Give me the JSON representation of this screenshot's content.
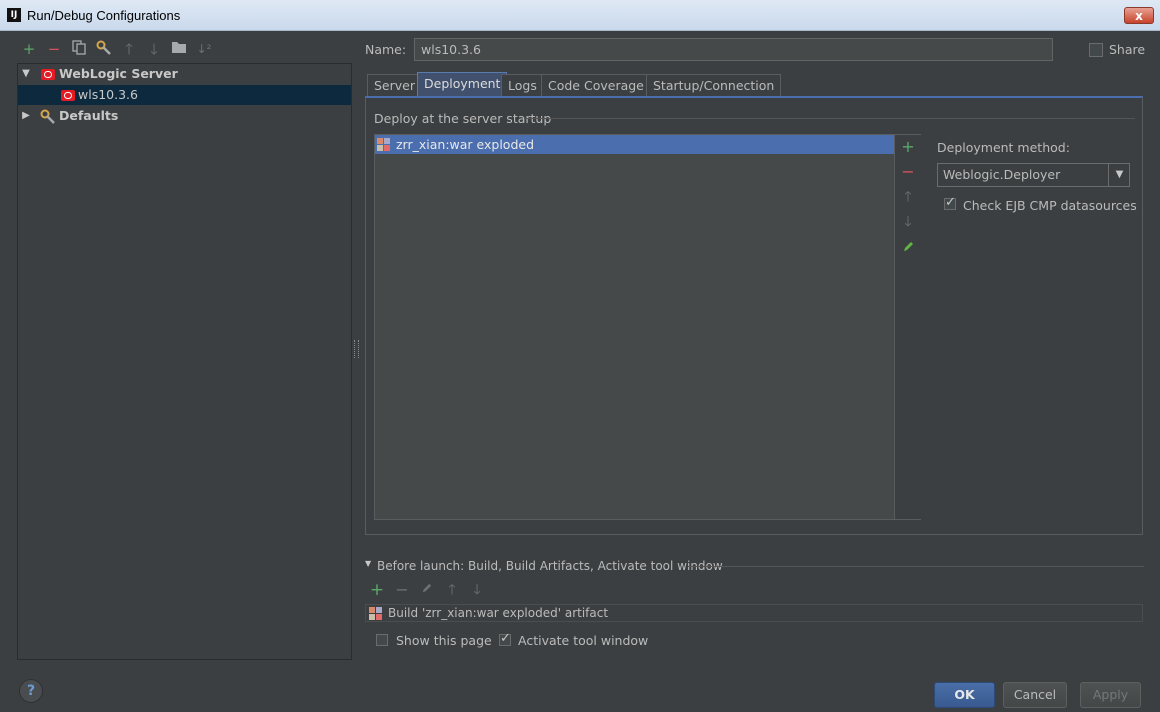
{
  "window": {
    "title": "Run/Debug Configurations",
    "app_icon": "intellij-logo-icon",
    "close_label": "x"
  },
  "toolbar": {
    "icons": [
      "add-icon",
      "remove-icon",
      "copy-icon",
      "edit-defaults-icon",
      "move-up-icon",
      "move-down-icon",
      "folder-icon",
      "sort-icon"
    ]
  },
  "tree": {
    "group_label": "WebLogic Server",
    "config_label": "wls10.3.6",
    "defaults_label": "Defaults"
  },
  "name_field": {
    "label": "Name:",
    "value": "wls10.3.6"
  },
  "share": {
    "label": "Share",
    "checked": false
  },
  "tabs": [
    "Server",
    "Deployment",
    "Logs",
    "Code Coverage",
    "Startup/Connection"
  ],
  "active_tab": "Deployment",
  "deploy": {
    "section_title": "Deploy at the server startup",
    "items": [
      "zrr_xian:war exploded"
    ]
  },
  "method": {
    "label": "Deployment method:",
    "selected": "Weblogic.Deployer",
    "ejb_check_label": "Check EJB CMP datasources",
    "ejb_checked": true
  },
  "before_launch": {
    "label": "Before launch: Build, Build Artifacts, Activate tool window",
    "item": "Build 'zrr_xian:war exploded' artifact",
    "show_page_label": "Show this page",
    "show_page_checked": false,
    "activate_label": "Activate tool window",
    "activate_checked": true
  },
  "buttons": {
    "help": "?",
    "ok": "OK",
    "cancel": "Cancel",
    "apply": "Apply"
  },
  "colors": {
    "background": "#3c3f41",
    "selection": "#4b6eaf",
    "add_green": "#59a869",
    "remove_red": "#d6545c",
    "oracle_red": "#e51b24"
  }
}
